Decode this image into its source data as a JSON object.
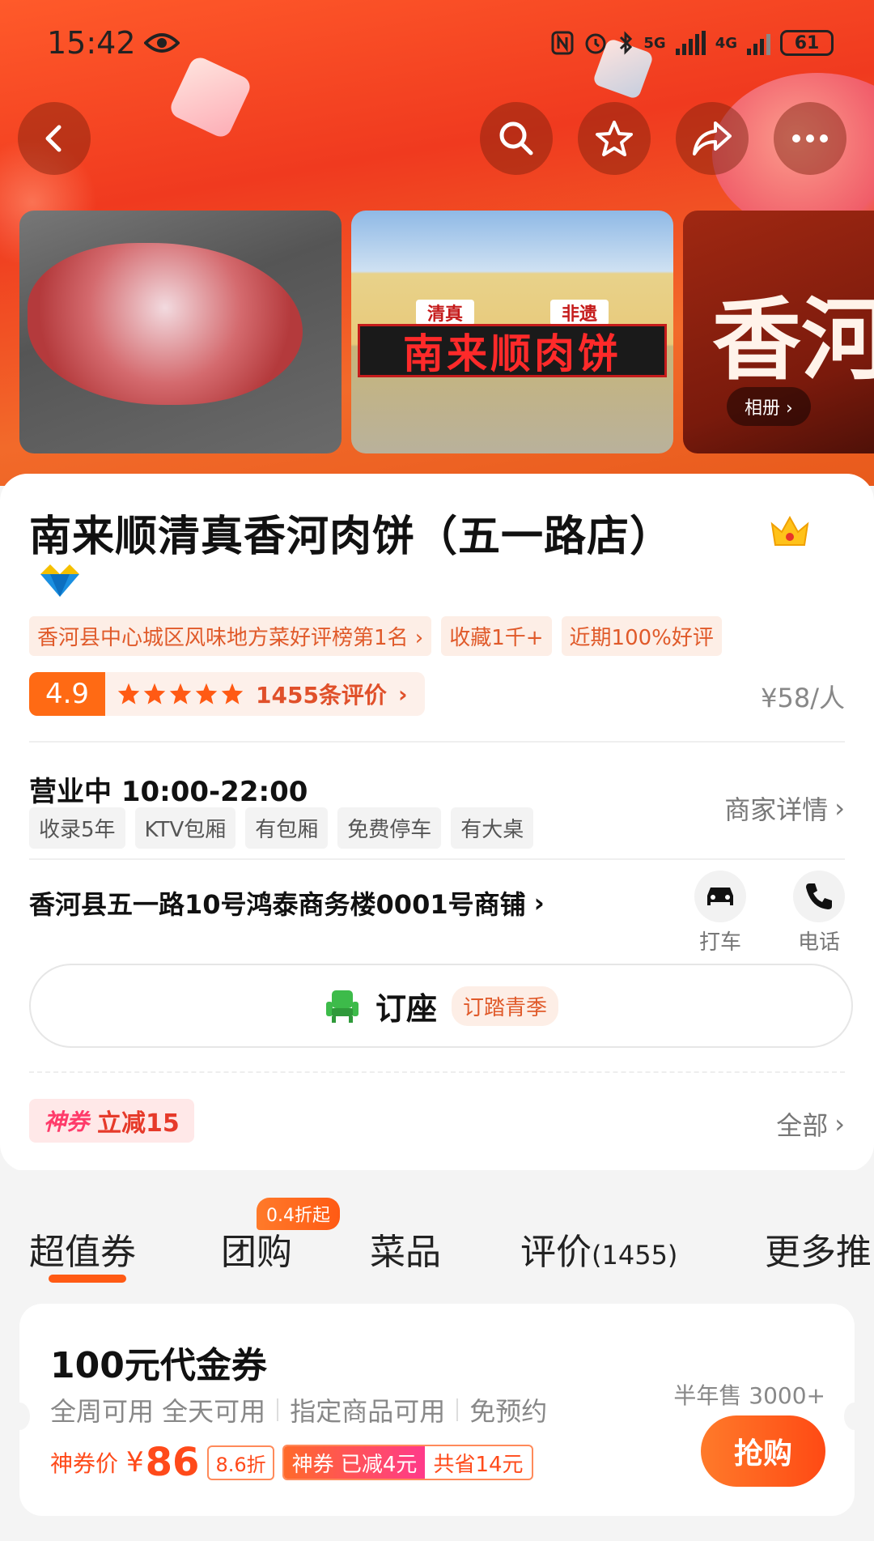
{
  "status_bar": {
    "time": "15:42",
    "signal_5g": "5G",
    "signal_4g": "4G",
    "battery": "61"
  },
  "photos": {
    "album_label": "相册",
    "photo3_text": "香河清",
    "storefront_sign": "南来顺肉饼",
    "storefront_upper_left": "清真",
    "storefront_upper_right": "非遗"
  },
  "shop": {
    "name": "南来顺清真香河肉饼（五一路店）",
    "tags": [
      "香河县中心城区风味地方菜好评榜第1名",
      "收藏1千+",
      "近期100%好评"
    ],
    "rating": "4.9",
    "stars": 5,
    "review_count": "1455条评价",
    "price": "¥58/人",
    "hours": "营业中 10:00-22:00",
    "features": [
      "收录5年",
      "KTV包厢",
      "有包厢",
      "免费停车",
      "有大桌"
    ],
    "detail_link": "商家详情",
    "address": "香河县五一路10号鸿泰商务楼0001号商铺",
    "taxi_label": "打车",
    "phone_label": "电话",
    "reserve_label": "订座",
    "reserve_badge": "订踏青季",
    "coupon_prefix": "神券",
    "coupon_text": "立减15",
    "all_label": "全部"
  },
  "tabs": {
    "items": [
      "超值券",
      "团购",
      "菜品",
      "评价",
      "更多推"
    ],
    "review_count": "(1455)",
    "groupbuy_badge": "0.4折起",
    "active": "超值券"
  },
  "deal": {
    "title": "100元代金券",
    "features": [
      "全周可用 全天可用",
      "指定商品可用",
      "免预约"
    ],
    "sold": "半年售 3000+",
    "price_label": "神券价",
    "currency": "¥",
    "price": "86",
    "discount": "8.6折",
    "shenquan_label": "神券 已减4元",
    "save_label": "共省14元",
    "buy_button": "抢购"
  },
  "colors": {
    "accent": "#ff5a14",
    "hero_bg": "#f03a1f",
    "rating_bg": "#ff6a14"
  }
}
